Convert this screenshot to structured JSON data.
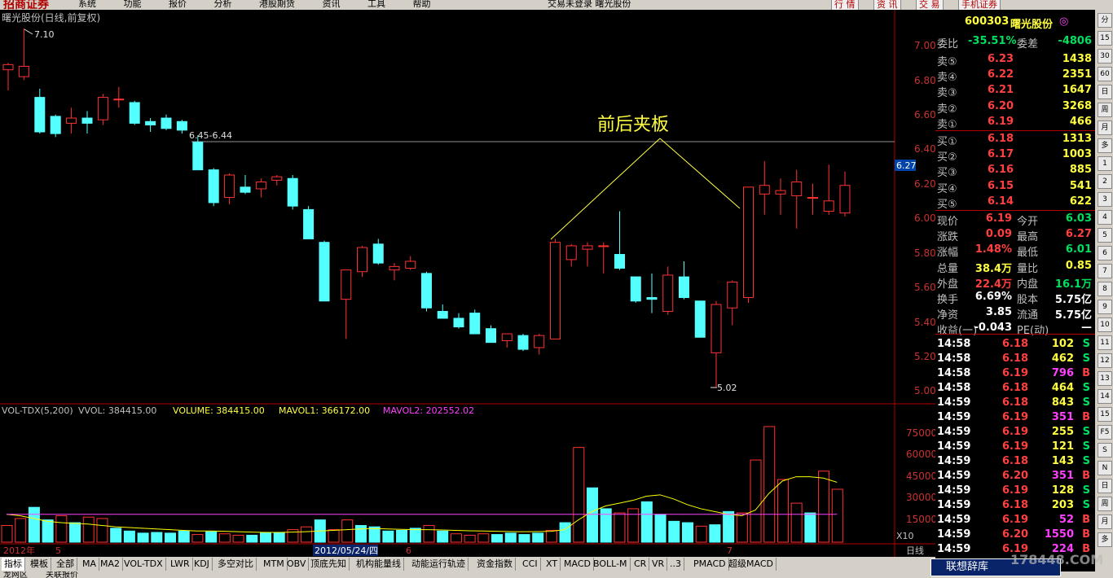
{
  "topbar": {
    "logo": "招商证券",
    "menu": [
      "系统",
      "功能",
      "报价",
      "分析",
      "港股期货",
      "资讯",
      "工具",
      "帮助"
    ],
    "center": "交易未登录  曙光股份",
    "right_buttons": [
      "行 情",
      "资 讯",
      "交 易",
      "手机证券"
    ]
  },
  "chart": {
    "title": "曙光股份(日线,前复权)",
    "annotation": "前后夹板",
    "high_label": "7.10",
    "low_label": "5.02",
    "level_label": "6.45-6.44",
    "current_price_tag": "6.27",
    "price_axis": [
      "7.00",
      "6.80",
      "6.60",
      "6.40",
      "6.20",
      "6.00",
      "5.80",
      "5.60",
      "5.40",
      "5.20",
      "5.00"
    ],
    "date_bar": {
      "year": "2012年",
      "m1": "5",
      "selected": "2012/05/24/四",
      "m2": "6",
      "m3": "7",
      "right": "日线"
    }
  },
  "chart_data": {
    "type": "candlestick",
    "ylim": [
      5.0,
      7.1
    ],
    "candles": [
      {
        "o": 6.86,
        "h": 6.9,
        "l": 6.74,
        "c": 6.89
      },
      {
        "o": 6.82,
        "h": 7.1,
        "l": 6.8,
        "c": 6.88
      },
      {
        "o": 6.7,
        "h": 6.75,
        "l": 6.49,
        "c": 6.5
      },
      {
        "o": 6.59,
        "h": 6.6,
        "l": 6.47,
        "c": 6.49
      },
      {
        "o": 6.55,
        "h": 6.64,
        "l": 6.49,
        "c": 6.58
      },
      {
        "o": 6.58,
        "h": 6.62,
        "l": 6.49,
        "c": 6.55
      },
      {
        "o": 6.57,
        "h": 6.72,
        "l": 6.54,
        "c": 6.7
      },
      {
        "o": 6.69,
        "h": 6.76,
        "l": 6.64,
        "c": 6.69
      },
      {
        "o": 6.67,
        "h": 6.68,
        "l": 6.54,
        "c": 6.55
      },
      {
        "o": 6.56,
        "h": 6.58,
        "l": 6.5,
        "c": 6.54
      },
      {
        "o": 6.58,
        "h": 6.6,
        "l": 6.51,
        "c": 6.52
      },
      {
        "o": 6.56,
        "h": 6.57,
        "l": 6.49,
        "c": 6.51
      },
      {
        "o": 6.44,
        "h": 6.48,
        "l": 6.3,
        "c": 6.28
      },
      {
        "o": 6.28,
        "h": 6.29,
        "l": 6.07,
        "c": 6.09
      },
      {
        "o": 6.12,
        "h": 6.26,
        "l": 6.08,
        "c": 6.25
      },
      {
        "o": 6.18,
        "h": 6.25,
        "l": 6.14,
        "c": 6.15
      },
      {
        "o": 6.17,
        "h": 6.23,
        "l": 6.12,
        "c": 6.21
      },
      {
        "o": 6.22,
        "h": 6.25,
        "l": 6.19,
        "c": 6.24
      },
      {
        "o": 6.23,
        "h": 6.25,
        "l": 6.05,
        "c": 6.07
      },
      {
        "o": 6.05,
        "h": 6.07,
        "l": 5.88,
        "c": 5.88
      },
      {
        "o": 5.86,
        "h": 5.87,
        "l": 5.54,
        "c": 5.52
      },
      {
        "o": 5.53,
        "h": 5.7,
        "l": 5.3,
        "c": 5.7
      },
      {
        "o": 5.69,
        "h": 5.84,
        "l": 5.66,
        "c": 5.83
      },
      {
        "o": 5.85,
        "h": 5.88,
        "l": 5.73,
        "c": 5.74
      },
      {
        "o": 5.7,
        "h": 5.74,
        "l": 5.64,
        "c": 5.72
      },
      {
        "o": 5.71,
        "h": 5.78,
        "l": 5.7,
        "c": 5.75
      },
      {
        "o": 5.68,
        "h": 5.69,
        "l": 5.46,
        "c": 5.48
      },
      {
        "o": 5.46,
        "h": 5.5,
        "l": 5.42,
        "c": 5.42
      },
      {
        "o": 5.42,
        "h": 5.45,
        "l": 5.36,
        "c": 5.37
      },
      {
        "o": 5.45,
        "h": 5.47,
        "l": 5.33,
        "c": 5.33
      },
      {
        "o": 5.36,
        "h": 5.38,
        "l": 5.28,
        "c": 5.28
      },
      {
        "o": 5.29,
        "h": 5.33,
        "l": 5.25,
        "c": 5.33
      },
      {
        "o": 5.32,
        "h": 5.33,
        "l": 5.23,
        "c": 5.24
      },
      {
        "o": 5.25,
        "h": 5.33,
        "l": 5.21,
        "c": 5.32
      },
      {
        "o": 5.3,
        "h": 5.88,
        "l": 5.3,
        "c": 5.86
      },
      {
        "o": 5.76,
        "h": 5.85,
        "l": 5.72,
        "c": 5.84
      },
      {
        "o": 5.82,
        "h": 5.86,
        "l": 5.72,
        "c": 5.84
      },
      {
        "o": 5.84,
        "h": 5.86,
        "l": 5.68,
        "c": 5.84
      },
      {
        "o": 5.79,
        "h": 6.04,
        "l": 5.7,
        "c": 5.71
      },
      {
        "o": 5.66,
        "h": 5.66,
        "l": 5.51,
        "c": 5.52
      },
      {
        "o": 5.54,
        "h": 5.68,
        "l": 5.45,
        "c": 5.53
      },
      {
        "o": 5.46,
        "h": 5.72,
        "l": 5.44,
        "c": 5.67
      },
      {
        "o": 5.66,
        "h": 5.75,
        "l": 5.53,
        "c": 5.54
      },
      {
        "o": 5.52,
        "h": 5.52,
        "l": 5.31,
        "c": 5.31
      },
      {
        "o": 5.22,
        "h": 5.52,
        "l": 5.02,
        "c": 5.5
      },
      {
        "o": 5.48,
        "h": 5.64,
        "l": 5.38,
        "c": 5.63
      },
      {
        "o": 5.54,
        "h": 6.18,
        "l": 5.51,
        "c": 6.18
      },
      {
        "o": 6.14,
        "h": 6.33,
        "l": 6.02,
        "c": 6.19
      },
      {
        "o": 6.14,
        "h": 6.23,
        "l": 6.02,
        "c": 6.16
      },
      {
        "o": 6.13,
        "h": 6.28,
        "l": 5.94,
        "c": 6.21
      },
      {
        "o": 6.12,
        "h": 6.2,
        "l": 6.02,
        "c": 6.12
      },
      {
        "o": 6.04,
        "h": 6.31,
        "l": 6.02,
        "c": 6.1
      },
      {
        "o": 6.03,
        "h": 6.27,
        "l": 6.01,
        "c": 6.19
      }
    ],
    "volume_ylim": [
      0,
      90000
    ],
    "volume_axis": [
      "75000",
      "60000",
      "45000",
      "30000",
      "15000"
    ],
    "volumes": [
      12000,
      17000,
      25000,
      16000,
      19000,
      14000,
      18000,
      17000,
      10000,
      8000,
      6500,
      7000,
      6500,
      8000,
      5500,
      7500,
      6000,
      5000,
      5000,
      7000,
      7000,
      9000,
      11000,
      16000,
      9000,
      16000,
      12000,
      11000,
      8000,
      8500,
      10000,
      12000,
      8000,
      6000,
      5000,
      6000,
      5500,
      6500,
      5500,
      6500,
      8500,
      14000,
      68000,
      39000,
      24000,
      21000,
      24000,
      29000,
      20000,
      15000,
      14000,
      11500,
      12500,
      22000,
      21000,
      59000,
      83000,
      45000,
      28000,
      21000,
      51000,
      38000
    ],
    "vol_up": [
      1,
      1,
      0,
      0,
      1,
      0,
      1,
      1,
      0,
      0,
      0,
      0,
      0,
      0,
      1,
      0,
      1,
      1,
      0,
      0,
      0,
      1,
      1,
      0,
      1,
      1,
      0,
      0,
      0,
      0,
      0,
      1,
      0,
      1,
      1,
      1,
      0,
      0,
      0,
      0,
      1,
      0,
      1,
      0,
      0,
      1,
      1,
      0,
      0,
      0,
      0,
      1,
      0,
      0,
      1,
      1,
      1,
      1,
      1,
      0,
      1,
      1
    ],
    "mavol1": [
      20000,
      19000,
      17000,
      15000,
      14000,
      13500,
      13000,
      12000,
      11000,
      10500,
      10000,
      9500,
      9000,
      8500,
      8000,
      8000,
      7800,
      7500,
      7200,
      7000,
      7000,
      7200,
      7500,
      8000,
      8500,
      9000,
      9500,
      9800,
      9500,
      9200,
      9000,
      9000,
      8800,
      8500,
      8200,
      8000,
      7800,
      7600,
      7500,
      7600,
      7800,
      9000,
      16000,
      22000,
      26000,
      28000,
      30000,
      33000,
      34000,
      31000,
      27000,
      24000,
      22000,
      20000,
      19000,
      23000,
      35000,
      44000,
      47000,
      47000,
      46000,
      43000
    ],
    "mavol2": 20000,
    "legend": {
      "name": "VOL-TDX(5,200)",
      "vvol": "VVOL: 384415.00",
      "volume": "VOLUME: 384415.00",
      "mavol1": "MAVOL1: 366172.00",
      "mavol2": "MAVOL2: 202552.02"
    },
    "multiplier": "X10"
  },
  "quote": {
    "code": "600303",
    "name": "曙光股份",
    "webi_label": "委比",
    "webi": "-35.51%",
    "weicha_label": "委差",
    "weicha": "-4806",
    "asks": [
      {
        "label": "卖⑤",
        "price": "6.23",
        "vol": "1438"
      },
      {
        "label": "卖④",
        "price": "6.22",
        "vol": "2351"
      },
      {
        "label": "卖③",
        "price": "6.21",
        "vol": "1647"
      },
      {
        "label": "卖②",
        "price": "6.20",
        "vol": "3268"
      },
      {
        "label": "卖①",
        "price": "6.19",
        "vol": "466"
      }
    ],
    "bids": [
      {
        "label": "买①",
        "price": "6.18",
        "vol": "1313"
      },
      {
        "label": "买②",
        "price": "6.17",
        "vol": "1003"
      },
      {
        "label": "买③",
        "price": "6.16",
        "vol": "885"
      },
      {
        "label": "买④",
        "price": "6.15",
        "vol": "541"
      },
      {
        "label": "买⑤",
        "price": "6.14",
        "vol": "622"
      }
    ],
    "stats": [
      {
        "l1": "现价",
        "v1": "6.19",
        "l2": "今开",
        "v2": "6.03",
        "c1": "red",
        "c2": "green"
      },
      {
        "l1": "涨跌",
        "v1": "0.09",
        "l2": "最高",
        "v2": "6.27",
        "c1": "red",
        "c2": "red"
      },
      {
        "l1": "涨幅",
        "v1": "1.48%",
        "l2": "最低",
        "v2": "6.01",
        "c1": "red",
        "c2": "green"
      },
      {
        "l1": "总量",
        "v1": "38.4万",
        "l2": "量比",
        "v2": "0.85",
        "c1": "yel",
        "c2": "yel"
      },
      {
        "l1": "外盘",
        "v1": "22.4万",
        "l2": "内盘",
        "v2": "16.1万",
        "c1": "red",
        "c2": "green"
      },
      {
        "l1": "换手",
        "v1": "6.69%",
        "l2": "股本",
        "v2": "5.75亿",
        "c1": "white",
        "c2": "white"
      },
      {
        "l1": "净资",
        "v1": "3.85",
        "l2": "流通",
        "v2": "5.75亿",
        "c1": "white",
        "c2": "white"
      },
      {
        "l1": "收益(一)",
        "v1": "-0.043",
        "l2": "PE(动)",
        "v2": "—",
        "c1": "white",
        "c2": "white"
      }
    ],
    "ticks": [
      {
        "t": "14:58",
        "p": "6.18",
        "v": "102",
        "s": "S"
      },
      {
        "t": "14:58",
        "p": "6.18",
        "v": "462",
        "s": "S"
      },
      {
        "t": "14:58",
        "p": "6.19",
        "v": "796",
        "s": "B"
      },
      {
        "t": "14:58",
        "p": "6.18",
        "v": "464",
        "s": "S"
      },
      {
        "t": "14:59",
        "p": "6.18",
        "v": "843",
        "s": "S"
      },
      {
        "t": "14:59",
        "p": "6.19",
        "v": "351",
        "s": "B"
      },
      {
        "t": "14:59",
        "p": "6.19",
        "v": "255",
        "s": "S"
      },
      {
        "t": "14:59",
        "p": "6.19",
        "v": "121",
        "s": "S"
      },
      {
        "t": "14:59",
        "p": "6.18",
        "v": "143",
        "s": "S"
      },
      {
        "t": "14:59",
        "p": "6.20",
        "v": "351",
        "s": "B"
      },
      {
        "t": "14:59",
        "p": "6.19",
        "v": "128",
        "s": "S"
      },
      {
        "t": "14:59",
        "p": "6.18",
        "v": "203",
        "s": "S"
      },
      {
        "t": "14:59",
        "p": "6.19",
        "v": "52",
        "s": "B"
      },
      {
        "t": "14:59",
        "p": "6.20",
        "v": "1550",
        "s": "B"
      },
      {
        "t": "14:59",
        "p": "6.19",
        "v": "224",
        "s": "B"
      }
    ]
  },
  "tabs": [
    "指标",
    "模板",
    "全部",
    "MA",
    "MA2",
    "VOL-TDX",
    "LWR",
    "KDJ",
    "多空对比",
    "MTM",
    "OBV",
    "顶底先知",
    "机构能量线",
    "动能运行轨迹",
    "资金指数",
    "CCI",
    "XT",
    "MACD",
    "BOLL-M",
    "CR",
    "VR",
    "..3",
    "PMACD",
    "超级MACD"
  ],
  "sidebar": [
    "分",
    "15",
    "30",
    "60",
    "日",
    "周",
    "月",
    "多",
    "1",
    "2",
    "3",
    "4",
    "5",
    "6",
    "7",
    "8",
    "9",
    "10",
    "11",
    "12",
    "13",
    "14",
    "15",
    "F5",
    "S",
    "N",
    "日",
    "周",
    "月",
    "多"
  ],
  "bottom": [
    "龙网区",
    "关联报价"
  ],
  "popup": "联想辞库",
  "watermark": "178448.COM",
  "colors": {
    "up": "#ff3232",
    "down": "#54ffff",
    "ma1": "#ffff00",
    "ma2": "#ff40ff",
    "axis": "#b00000"
  }
}
